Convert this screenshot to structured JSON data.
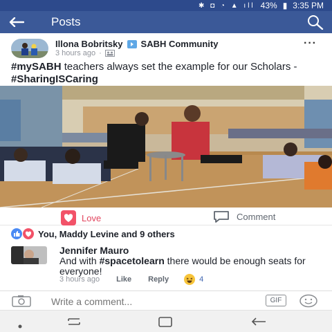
{
  "status_bar": {
    "battery": "43%",
    "time": "3:35 PM"
  },
  "app_bar": {
    "title": "Posts"
  },
  "post": {
    "author": "Illona Bobritsky",
    "group": "SABH Community",
    "time": "3 hours ago",
    "text_hashtag1": "#mySABH",
    "text_mid": " teachers always set the example for our Scholars - ",
    "text_hashtag2": "#SharingISCaring"
  },
  "actions": {
    "love": "Love",
    "comment": "Comment"
  },
  "reactions": {
    "summary": "You, Maddy Levine and 9 others"
  },
  "comment": {
    "author": "Jennifer Mauro",
    "text_pre": "And with ",
    "text_hashtag": "#spacetolearn",
    "text_post": " there would be enough seats for everyone!",
    "time": "3 hours ago",
    "like": "Like",
    "reply": "Reply",
    "reaction_count": "4"
  },
  "composer": {
    "placeholder": "Write a comment...",
    "gif": "GIF"
  },
  "colors": {
    "header_blue": "#3b5998",
    "status_blue": "#2d4a8c",
    "love_red": "#e2455e",
    "link_blue": "#4267b2"
  },
  "icons": [
    "back-arrow-icon",
    "search-icon",
    "group-arrow-icon",
    "group-privacy-icon",
    "more-icon",
    "heart-icon",
    "comment-bubble-icon",
    "like-reaction-icon",
    "love-reaction-icon",
    "haha-reaction-icon",
    "camera-icon",
    "sticker-icon",
    "nav-dot-icon",
    "recent-apps-icon",
    "home-icon",
    "nav-back-icon"
  ]
}
